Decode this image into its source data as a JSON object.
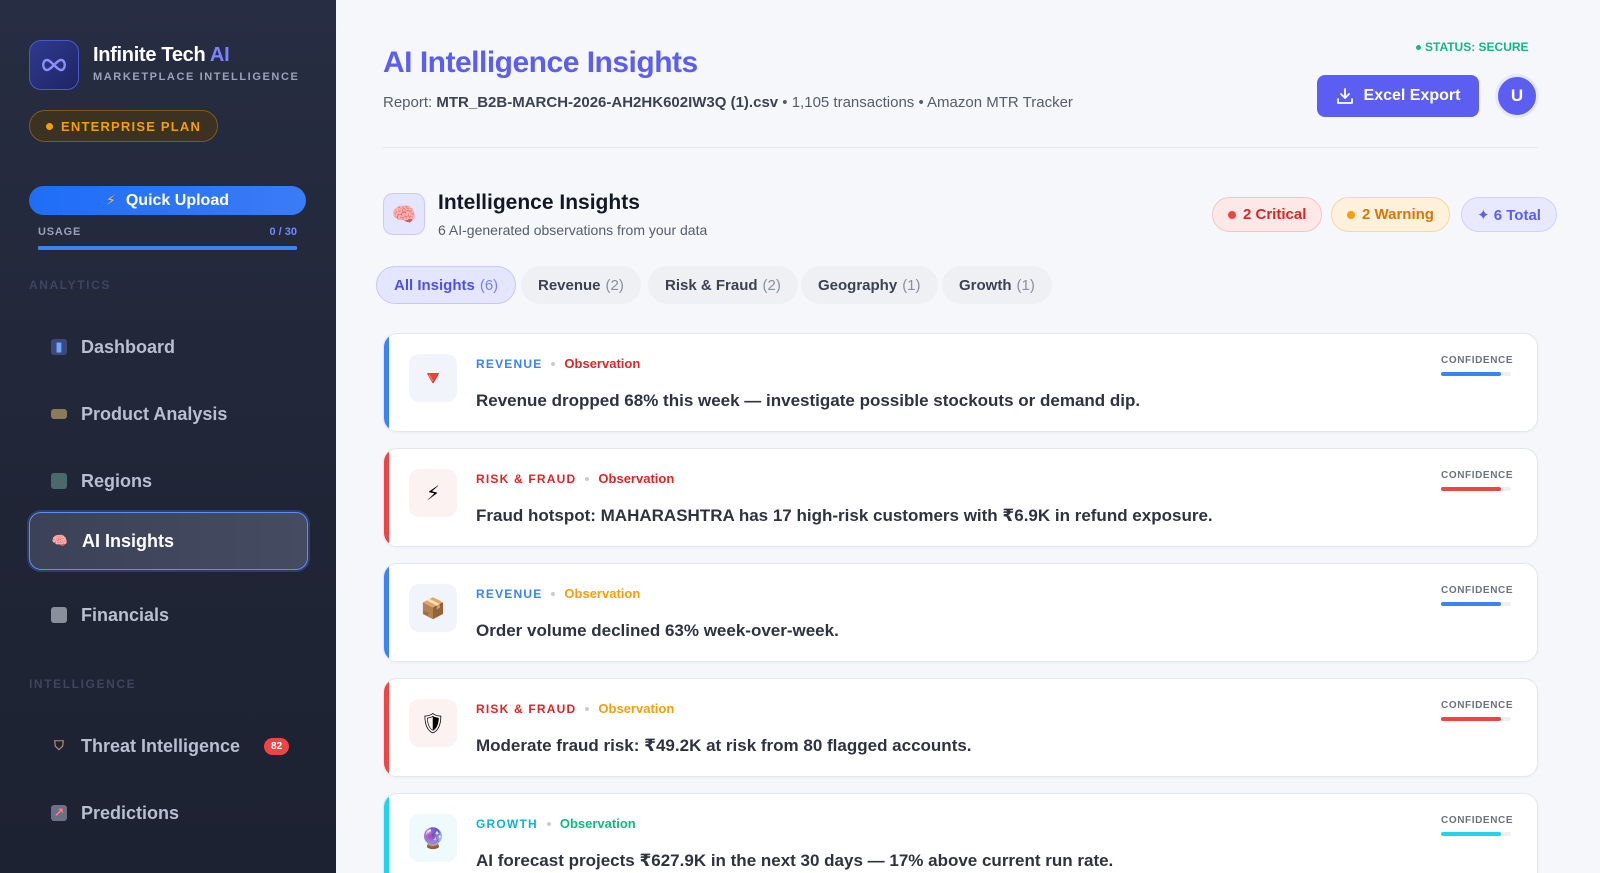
{
  "brand": {
    "name": "Infinite Tech",
    "name_ai": "AI",
    "subtitle": "MARKETPLACE INTELLIGENCE"
  },
  "plan": {
    "label": "ENTERPRISE PLAN"
  },
  "sidebar": {
    "upload_label": "Quick Upload",
    "usage_label": "USAGE",
    "usage_value": "0 / 30",
    "usage_fraction": 1.0,
    "section_analytics": "ANALYTICS",
    "section_intelligence": "INTELLIGENCE",
    "items": [
      {
        "label": "Dashboard",
        "icon": "bar-chart-icon"
      },
      {
        "label": "Product Analysis",
        "icon": "tag-icon"
      },
      {
        "label": "Regions",
        "icon": "map-icon"
      },
      {
        "label": "AI Insights",
        "icon": "brain-icon",
        "active": true
      },
      {
        "label": "Financials",
        "icon": "receipt-icon"
      },
      {
        "label": "Threat Intelligence",
        "icon": "shield-icon",
        "badge": "82"
      },
      {
        "label": "Predictions",
        "icon": "trend-chart-icon"
      }
    ]
  },
  "header": {
    "title": "AI Intelligence Insights",
    "report_prefix": "Report:",
    "report_file": "MTR_B2B-MARCH-2026-AH2HK602IW3Q (1).csv",
    "report_suffix": "• 1,105 transactions • Amazon MTR Tracker",
    "status": "STATUS: SECURE",
    "export_label": "Excel Export",
    "avatar_initial": "U"
  },
  "insights": {
    "title": "Intelligence Insights",
    "subtitle": "6 AI-generated observations from your data",
    "critical": "2 Critical",
    "warning": "2 Warning",
    "total": "✦ 6 Total"
  },
  "tabs": [
    {
      "label": "All Insights",
      "count": "(6)",
      "active": true
    },
    {
      "label": "Revenue",
      "count": "(2)"
    },
    {
      "label": "Risk & Fraud",
      "count": "(2)"
    },
    {
      "label": "Geography",
      "count": "(1)"
    },
    {
      "label": "Growth",
      "count": "(1)"
    }
  ],
  "cards": [
    {
      "category": "REVENUE",
      "type": "Observation",
      "message": "Revenue dropped 68% this week — investigate possible stockouts or demand dip.",
      "icon": "down-triangle-icon",
      "glyph": "🔻",
      "accent": "#3b82f6",
      "cat_color": "#3b82f6",
      "type_color": "#dc2626",
      "icon_bg": "#f1f5fb",
      "confidence": 0.85
    },
    {
      "category": "RISK & FRAUD",
      "type": "Observation",
      "message": "Fraud hotspot: MAHARASHTRA has 17 high-risk customers with ₹6.9K in refund exposure.",
      "icon": "lightning-icon",
      "glyph": "⚡",
      "accent": "#ef4444",
      "cat_color": "#dc2626",
      "type_color": "#dc2626",
      "icon_bg": "#fdf2f2",
      "confidence": 0.85
    },
    {
      "category": "REVENUE",
      "type": "Observation",
      "message": "Order volume declined 63% week-over-week.",
      "icon": "package-icon",
      "glyph": "📦",
      "accent": "#3b82f6",
      "cat_color": "#3b82f6",
      "type_color": "#f59e0b",
      "icon_bg": "#f1f5fb",
      "confidence": 0.85
    },
    {
      "category": "RISK & FRAUD",
      "type": "Observation",
      "message": "Moderate fraud risk: ₹49.2K at risk from 80 flagged accounts.",
      "icon": "shield-icon",
      "glyph": "🛡",
      "accent": "#ef4444",
      "cat_color": "#dc2626",
      "type_color": "#f59e0b",
      "icon_bg": "#fdf2f2",
      "confidence": 0.85
    },
    {
      "category": "GROWTH",
      "type": "Observation",
      "message": "AI forecast projects ₹627.9K in the next 30 days — 17% above current run rate.",
      "icon": "crystal-ball-icon",
      "glyph": "🔮",
      "accent": "#22d3ee",
      "cat_color": "#06b6d4",
      "type_color": "#10b981",
      "icon_bg": "#effafc",
      "confidence": 0.85
    }
  ],
  "confidence_label": "CONFIDENCE"
}
